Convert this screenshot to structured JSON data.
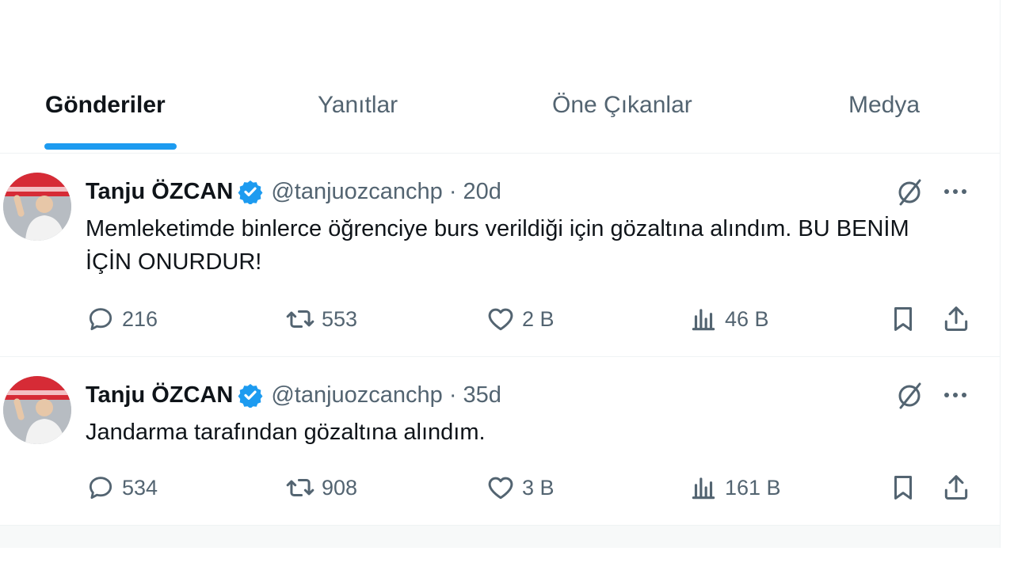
{
  "tabs": [
    {
      "label": "Gönderiler",
      "active": true
    },
    {
      "label": "Yanıtlar",
      "active": false
    },
    {
      "label": "Öne Çıkanlar",
      "active": false
    },
    {
      "label": "Medya",
      "active": false
    }
  ],
  "colors": {
    "accent": "#1d9bf0",
    "text": "#0f1419",
    "muted": "#536471",
    "divider": "#eff3f4"
  },
  "posts": [
    {
      "author": "Tanju ÖZCAN",
      "handle": "@tanjuozcanchp",
      "separator": "·",
      "time": "20d",
      "verified": true,
      "text": "Memleketimde binlerce öğrenciye burs verildiği için gözaltına alındım. BU BENİM İÇİN ONURDUR!",
      "replies": "216",
      "reposts": "553",
      "likes": "2 B",
      "views": "46 B"
    },
    {
      "author": "Tanju ÖZCAN",
      "handle": "@tanjuozcanchp",
      "separator": "·",
      "time": "35d",
      "verified": true,
      "text": "Jandarma tarafından gözaltına alındım.",
      "replies": "534",
      "reposts": "908",
      "likes": "3 B",
      "views": "161 B"
    }
  ],
  "icons": [
    "verified-badge-icon",
    "grok-icon",
    "more-icon",
    "reply-icon",
    "repost-icon",
    "like-icon",
    "views-icon",
    "bookmark-icon",
    "share-icon"
  ]
}
